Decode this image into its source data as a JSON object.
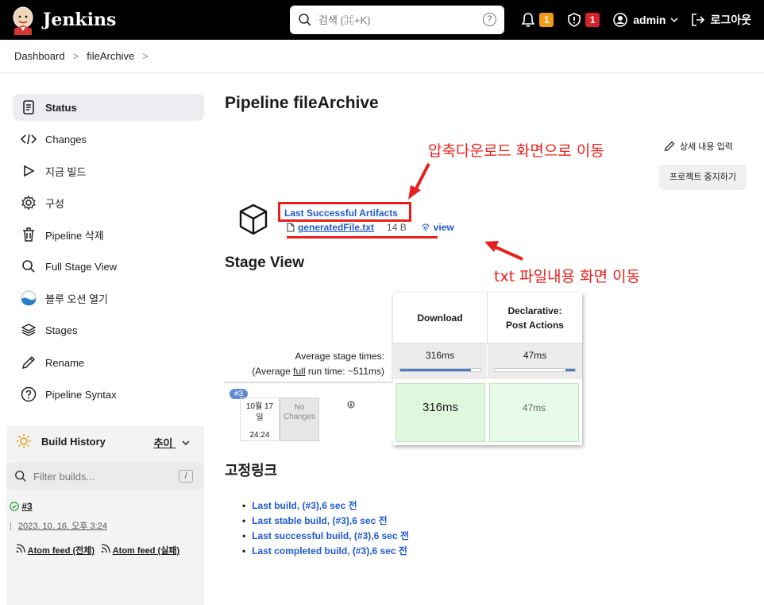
{
  "app": {
    "name": "Jenkins"
  },
  "topbar": {
    "search_placeholder": "검색 (⌘+K)",
    "help": "?",
    "notifications_count": "1",
    "security_count": "1",
    "user": "admin",
    "logout": "로그아웃"
  },
  "breadcrumb": {
    "items": [
      "Dashboard",
      "fileArchive"
    ],
    "sep": ">"
  },
  "sidebar": {
    "items": [
      {
        "label": "Status",
        "icon": "status-doc-icon"
      },
      {
        "label": "Changes",
        "icon": "code-icon"
      },
      {
        "label": "지금 빌드",
        "icon": "play-icon"
      },
      {
        "label": "구성",
        "icon": "gear-icon"
      },
      {
        "label": "Pipeline 삭제",
        "icon": "trash-icon"
      },
      {
        "label": "Full Stage View",
        "icon": "search-icon"
      },
      {
        "label": "블루 오션 열기",
        "icon": "blue-ocean-icon"
      },
      {
        "label": "Stages",
        "icon": "stack-icon"
      },
      {
        "label": "Rename",
        "icon": "pencil-icon"
      },
      {
        "label": "Pipeline Syntax",
        "icon": "help-circle-icon"
      }
    ]
  },
  "build_history": {
    "title": "Build History",
    "trend": "추이",
    "filter_placeholder": "Filter builds...",
    "filter_shortcut": "/",
    "build_number": "#3",
    "build_date": "2023. 10. 16. 오후 3:24",
    "atom_all": "Atom feed (전체)",
    "atom_fail": "Atom feed (실패)"
  },
  "main": {
    "title": "Pipeline fileArchive",
    "edit_description": "상세 내용 입력",
    "disable_project": "프로젝트 중지하기",
    "artifacts_title": "Last Successful Artifacts",
    "artifact_file": "generatedFile.txt",
    "artifact_size": "14 B",
    "artifact_view": "view",
    "annotation_top": "압축다운로드 화면으로 이동",
    "annotation_bottom": "txt 파일내용 화면 이동"
  },
  "stage_view": {
    "title": "Stage View",
    "avg_label": "Average stage times:",
    "avg_run_prefix": "(Average ",
    "avg_run_link": "full",
    "avg_run_suffix": " run time: ~511ms)",
    "stages": [
      {
        "name_line1": "Download",
        "name_line2": "",
        "avg": "316ms",
        "bar_fraction": 0.88,
        "bar_start": 0.0,
        "cell": "316ms"
      },
      {
        "name_line1": "Declarative:",
        "name_line2": "Post Actions",
        "avg": "47ms",
        "bar_fraction": 0.12,
        "bar_start": 0.88,
        "cell": "47ms"
      }
    ],
    "build": {
      "badge": "#3",
      "date_line1": "10월 17",
      "date_line2": "일",
      "time": "24:24",
      "no_changes_1": "No",
      "no_changes_2": "Changes"
    }
  },
  "permalinks": {
    "title": "고정링크",
    "items": [
      "Last build, (#3),6 sec 전",
      "Last stable build, (#3),6 sec 전",
      "Last successful build, (#3),6 sec 전",
      "Last completed build, (#3),6 sec 전"
    ]
  },
  "colors": {
    "annotation_red": "#e8201d",
    "success_green": "#dff7df",
    "link_blue": "#1f5bd4"
  }
}
